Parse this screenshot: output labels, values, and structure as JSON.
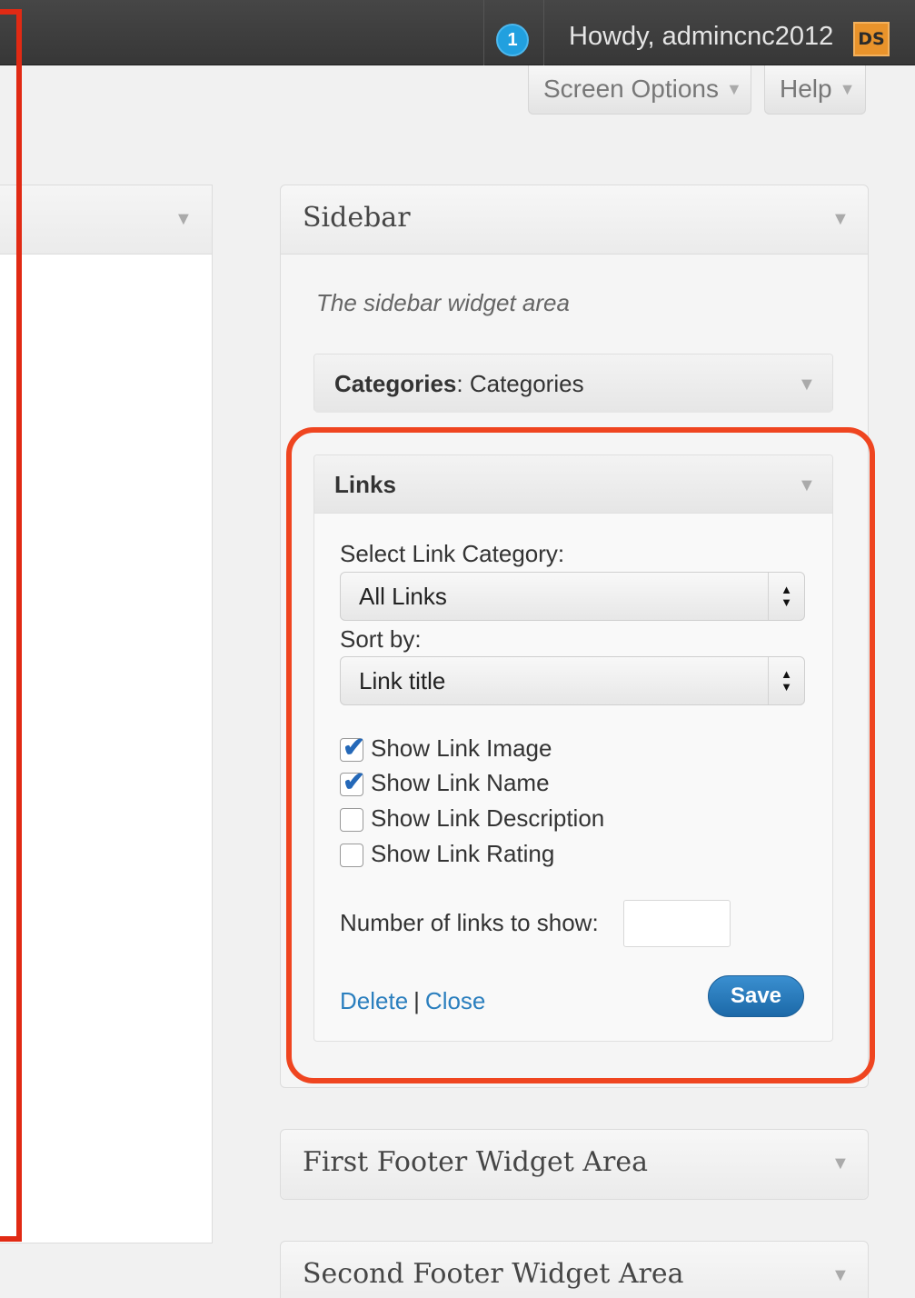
{
  "adminbar": {
    "notification_count": "1",
    "howdy_text": "Howdy, admincnc2012",
    "avatar_text": "DS"
  },
  "screen_meta": {
    "screen_options_label": "Screen Options",
    "help_label": "Help"
  },
  "sidebar_area": {
    "title": "Sidebar",
    "description": "The sidebar widget area",
    "widgets": {
      "categories": {
        "title_bold": "Categories",
        "title_rest": ": Categories"
      },
      "links": {
        "title": "Links",
        "select_category_label": "Select Link Category:",
        "select_category_value": "All Links",
        "sort_by_label": "Sort by:",
        "sort_by_value": "Link title",
        "checkboxes": [
          {
            "label": "Show Link Image",
            "checked": true
          },
          {
            "label": "Show Link Name",
            "checked": true
          },
          {
            "label": "Show Link Description",
            "checked": false
          },
          {
            "label": "Show Link Rating",
            "checked": false
          }
        ],
        "number_label": "Number of links to show:",
        "number_value": "",
        "delete_label": "Delete",
        "separator": "|",
        "close_label": "Close",
        "save_label": "Save"
      }
    }
  },
  "footer_areas": {
    "first": "First Footer Widget Area",
    "second": "Second Footer Widget Area"
  },
  "colors": {
    "annotation": "#e12a14",
    "link": "#2b7fbe",
    "save_button": "#1c69a8"
  }
}
